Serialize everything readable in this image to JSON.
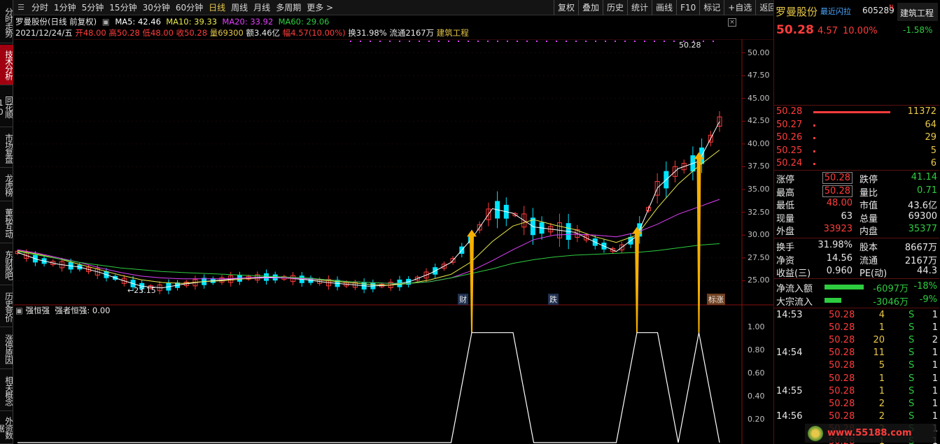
{
  "sidebar": {
    "items": [
      "分时走势",
      "技术分析",
      "同花顺10",
      "市场复盘",
      "龙虎榜",
      "董秘互动",
      "东财股吧",
      "历史竞价",
      "涨停原因",
      "相关概念",
      "外资数据"
    ]
  },
  "toolbar": {
    "periods": [
      "分时",
      "1分钟",
      "5分钟",
      "15分钟",
      "30分钟",
      "60分钟",
      "日线",
      "周线",
      "月线",
      "多周期",
      "更多"
    ],
    "active_period": "日线",
    "more_arrow": ">",
    "right_buttons": [
      "复权",
      "叠加",
      "历史",
      "统计",
      "画线",
      "F10",
      "标记",
      "+自选",
      "返回"
    ]
  },
  "chart_header": {
    "stock_title": "罗曼股份(日线 前复权)",
    "ma5_label": "MA5: 42.46",
    "ma10_label": "MA10: 39.33",
    "ma20_label": "MA20: 33.92",
    "ma60_label": "MA60: 29.06",
    "date": "2021/12/24/五",
    "open": "开48.00",
    "high": "高50.28",
    "low": "低48.00",
    "close": "收50.28",
    "volume": "量69300",
    "amount": "额3.46亿",
    "change": "幅4.57(10.00%)",
    "turnover": "换31.98%",
    "float": "流通2167万",
    "industry": "建筑工程"
  },
  "indicator_header": {
    "name": "强恒强",
    "value": "强者恒强: 0.00"
  },
  "chart_annotations": {
    "high_label": "50.28",
    "low_label": "←23.15",
    "markers": [
      "财",
      "跌",
      "标涨"
    ]
  },
  "price_axis": [
    "50.00",
    "47.50",
    "45.00",
    "42.50",
    "40.00",
    "37.50",
    "35.00",
    "32.50",
    "30.00",
    "27.50",
    "25.00"
  ],
  "indicator_axis": [
    "1.00",
    "0.80",
    "0.60",
    "0.40",
    "0.20"
  ],
  "chart_data": {
    "type": "line",
    "ylim": [
      22.5,
      51.5
    ],
    "series": [
      {
        "name": "MA5",
        "values": [
          28.1,
          27.3,
          26.8,
          26.5,
          25.9,
          25.1,
          24.4,
          24.2,
          24.6,
          24.9,
          25.1,
          25.3,
          25.4,
          25.3,
          25.1,
          24.8,
          24.6,
          24.4,
          24.5,
          24.9,
          25.8,
          27.0,
          29.6,
          32.9,
          32.4,
          30.9,
          30.6,
          30.3,
          29.2,
          28.2,
          29.9,
          35.2,
          37.3,
          38.1,
          42.46
        ]
      },
      {
        "name": "MA10",
        "values": [
          28.3,
          27.9,
          27.4,
          26.8,
          26.2,
          25.6,
          25.1,
          24.8,
          24.7,
          24.9,
          25.0,
          25.2,
          25.3,
          25.3,
          25.2,
          25.0,
          24.8,
          24.6,
          24.5,
          24.7,
          25.1,
          25.7,
          27.1,
          29.3,
          31.0,
          31.7,
          31.1,
          30.6,
          29.8,
          29.2,
          30.0,
          33.0,
          35.6,
          37.6,
          39.33
        ]
      },
      {
        "name": "MA20",
        "values": [
          28.4,
          28.0,
          27.5,
          27.0,
          26.4,
          25.9,
          25.5,
          25.3,
          25.2,
          25.2,
          25.2,
          25.3,
          25.3,
          25.3,
          25.2,
          25.1,
          24.9,
          24.8,
          24.7,
          24.7,
          24.9,
          25.3,
          26.1,
          27.2,
          28.4,
          29.5,
          30.0,
          30.1,
          30.0,
          29.8,
          30.3,
          31.2,
          32.3,
          33.1,
          33.92
        ]
      },
      {
        "name": "MA60",
        "values": [
          28.2,
          27.8,
          27.4,
          27.0,
          26.7,
          26.4,
          26.2,
          26.0,
          25.9,
          25.8,
          25.7,
          25.6,
          25.5,
          25.4,
          25.3,
          25.1,
          24.9,
          24.8,
          24.7,
          24.7,
          24.9,
          25.3,
          25.8,
          26.3,
          26.9,
          27.3,
          27.6,
          27.8,
          27.9,
          28.0,
          28.1,
          28.3,
          28.6,
          28.9,
          29.06
        ]
      }
    ],
    "indicator": {
      "name": "强者恒强",
      "values": [
        0,
        0,
        0,
        0,
        0,
        0,
        0,
        0,
        0,
        0,
        0,
        0,
        0,
        0,
        0,
        0,
        0,
        0,
        0,
        0,
        0,
        0,
        1,
        1,
        1,
        0,
        0,
        0,
        0,
        0,
        1,
        1,
        0,
        1,
        0
      ],
      "ylim": [
        0,
        1.1
      ]
    }
  },
  "right_panel": {
    "stock_name": "罗曼股份",
    "tag": "最近闪拉",
    "code": "605289",
    "badge": "N",
    "sector": "建筑工程",
    "sector_change": "-1.58%",
    "price": "50.28",
    "change": "4.57",
    "pct": "10.00%",
    "bids": [
      {
        "price": "50.28",
        "volume": "11372"
      },
      {
        "price": "50.27",
        "volume": "64"
      },
      {
        "price": "50.26",
        "volume": "29"
      },
      {
        "price": "50.25",
        "volume": "5"
      },
      {
        "price": "50.24",
        "volume": "6"
      }
    ],
    "stats": [
      {
        "l1": "涨停",
        "v1": "50.28",
        "l2": "跌停",
        "v2": "41.14"
      },
      {
        "l1": "最高",
        "v1": "50.28",
        "l2": "量比",
        "v2": "0.71"
      },
      {
        "l1": "最低",
        "v1": "48.00",
        "l2": "市值",
        "v2": "43.6亿"
      },
      {
        "l1": "现量",
        "v1": "63",
        "l2": "总量",
        "v2": "69300"
      },
      {
        "l1": "外盘",
        "v1": "33923",
        "l2": "内盘",
        "v2": "35377"
      }
    ],
    "stats2": [
      {
        "l1": "换手",
        "v1": "31.98%",
        "l2": "股本",
        "v2": "8667万"
      },
      {
        "l1": "净资",
        "v1": "14.56",
        "l2": "流通",
        "v2": "2167万"
      },
      {
        "l1": "收益(三)",
        "v1": "0.960",
        "l2": "PE(动)",
        "v2": "44.3"
      }
    ],
    "flows": [
      {
        "label": "净流入额",
        "value": "-6097万",
        "pct": "-18%"
      },
      {
        "label": "大宗流入",
        "value": "-3046万",
        "pct": "-9%"
      }
    ],
    "ticks": [
      {
        "time": "14:53",
        "price": "50.28",
        "vol": "4",
        "side": "S",
        "n": "1"
      },
      {
        "time": "",
        "price": "50.28",
        "vol": "1",
        "side": "S",
        "n": "1"
      },
      {
        "time": "",
        "price": "50.28",
        "vol": "20",
        "side": "S",
        "n": "2"
      },
      {
        "time": "14:54",
        "price": "50.28",
        "vol": "11",
        "side": "S",
        "n": "1"
      },
      {
        "time": "",
        "price": "50.28",
        "vol": "5",
        "side": "S",
        "n": "1"
      },
      {
        "time": "",
        "price": "50.28",
        "vol": "1",
        "side": "S",
        "n": "1"
      },
      {
        "time": "14:55",
        "price": "50.28",
        "vol": "1",
        "side": "S",
        "n": "1"
      },
      {
        "time": "",
        "price": "50.28",
        "vol": "2",
        "side": "S",
        "n": "1"
      },
      {
        "time": "14:56",
        "price": "50.28",
        "vol": "2",
        "side": "S",
        "n": "1"
      },
      {
        "time": "",
        "price": "50.28",
        "vol": "2",
        "side": "S",
        "n": "1"
      },
      {
        "time": "",
        "price": "50.28",
        "vol": "1",
        "side": "S",
        "n": "1"
      }
    ],
    "watermark": "www.55188.com"
  },
  "colors": {
    "up": "#ff3c3c",
    "down": "#00e5ff",
    "ma5": "#ffffff",
    "ma10": "#e8e84a",
    "ma20": "#e040fb",
    "ma60": "#2ecc40",
    "arrow": "#f5b000"
  }
}
